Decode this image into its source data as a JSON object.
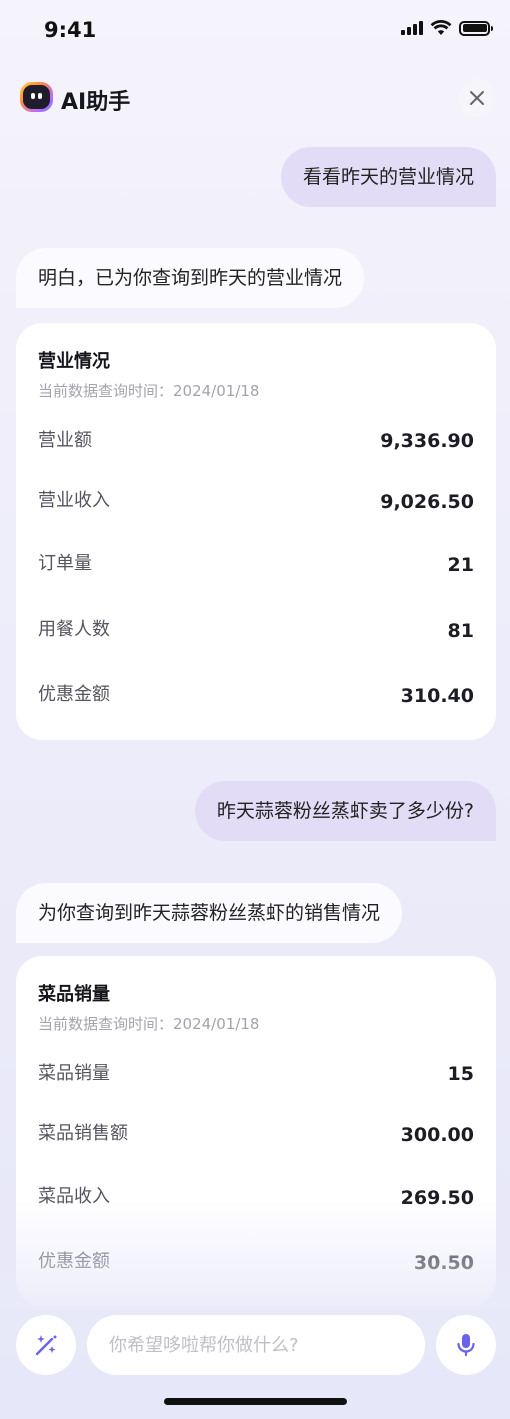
{
  "status_bar": {
    "time": "9:41"
  },
  "header": {
    "title": "AI助手"
  },
  "messages": {
    "user_1": "看看昨天的营业情况",
    "ai_1": "明白，已为你查询到昨天的营业情况",
    "user_2": "昨天蒜蓉粉丝蒸虾卖了多少份?",
    "ai_2": "为你查询到昨天蒜蓉粉丝蒸虾的销售情况"
  },
  "card_business": {
    "title": "营业情况",
    "subtitle": "当前数据查询时间：2024/01/18",
    "rows": [
      {
        "label": "营业额",
        "value": "9,336.90"
      },
      {
        "label": "营业收入",
        "value": "9,026.50"
      },
      {
        "label": "订单量",
        "value": "21"
      },
      {
        "label": "用餐人数",
        "value": "81"
      },
      {
        "label": "优惠金额",
        "value": "310.40"
      }
    ]
  },
  "card_dish": {
    "title": "菜品销量",
    "subtitle": "当前数据查询时间：2024/01/18",
    "rows": [
      {
        "label": "菜品销量",
        "value": "15"
      },
      {
        "label": "菜品销售额",
        "value": "300.00"
      },
      {
        "label": "菜品收入",
        "value": "269.50"
      },
      {
        "label": "优惠金额",
        "value": "30.50"
      }
    ]
  },
  "input": {
    "placeholder": "你希望哆啦帮你做什么?"
  },
  "icons": {
    "close": "close-icon",
    "magic": "magic-wand-icon",
    "mic": "microphone-icon",
    "logo": "ai-assistant-logo"
  },
  "colors": {
    "user_bubble": "#e3dcf7",
    "accent": "#6b63e6",
    "background": "#eeedfa"
  }
}
